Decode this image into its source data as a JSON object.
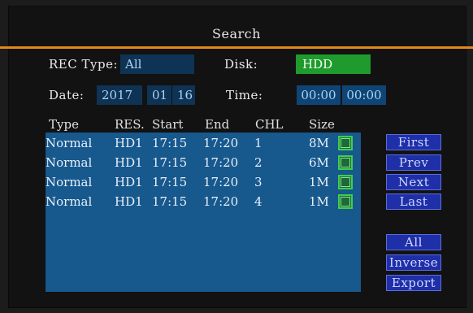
{
  "title": "Search",
  "filters": {
    "rec_type_label": "REC Type:",
    "rec_type_value": "All",
    "disk_label": "Disk:",
    "disk_value": "HDD",
    "date_label": "Date:",
    "date_year": "2017",
    "date_month": "01",
    "date_day": "16",
    "time_label": "Time:",
    "time_start": "00:00",
    "time_end": "00:00"
  },
  "table": {
    "headers": [
      "Type",
      "RES.",
      "Start",
      "End",
      "CHL",
      "Size"
    ],
    "rows": [
      {
        "type": "Normal",
        "res": "HD1",
        "start": "17:15",
        "end": "17:20",
        "chl": "1",
        "size": "8M"
      },
      {
        "type": "Normal",
        "res": "HD1",
        "start": "17:15",
        "end": "17:20",
        "chl": "2",
        "size": "6M"
      },
      {
        "type": "Normal",
        "res": "HD1",
        "start": "17:15",
        "end": "17:20",
        "chl": "3",
        "size": "1M"
      },
      {
        "type": "Normal",
        "res": "HD1",
        "start": "17:15",
        "end": "17:20",
        "chl": "4",
        "size": "1M"
      }
    ]
  },
  "buttons": {
    "first": "First",
    "prev": "Prev",
    "next": "Next",
    "last": "Last",
    "all": "All",
    "inverse": "Inverse",
    "export": "Export"
  },
  "colors": {
    "accent_line": "#e4871c",
    "list_bg": "#17588d",
    "disk_bg": "#1f9a2c",
    "button_bg": "#1f2fa8"
  }
}
